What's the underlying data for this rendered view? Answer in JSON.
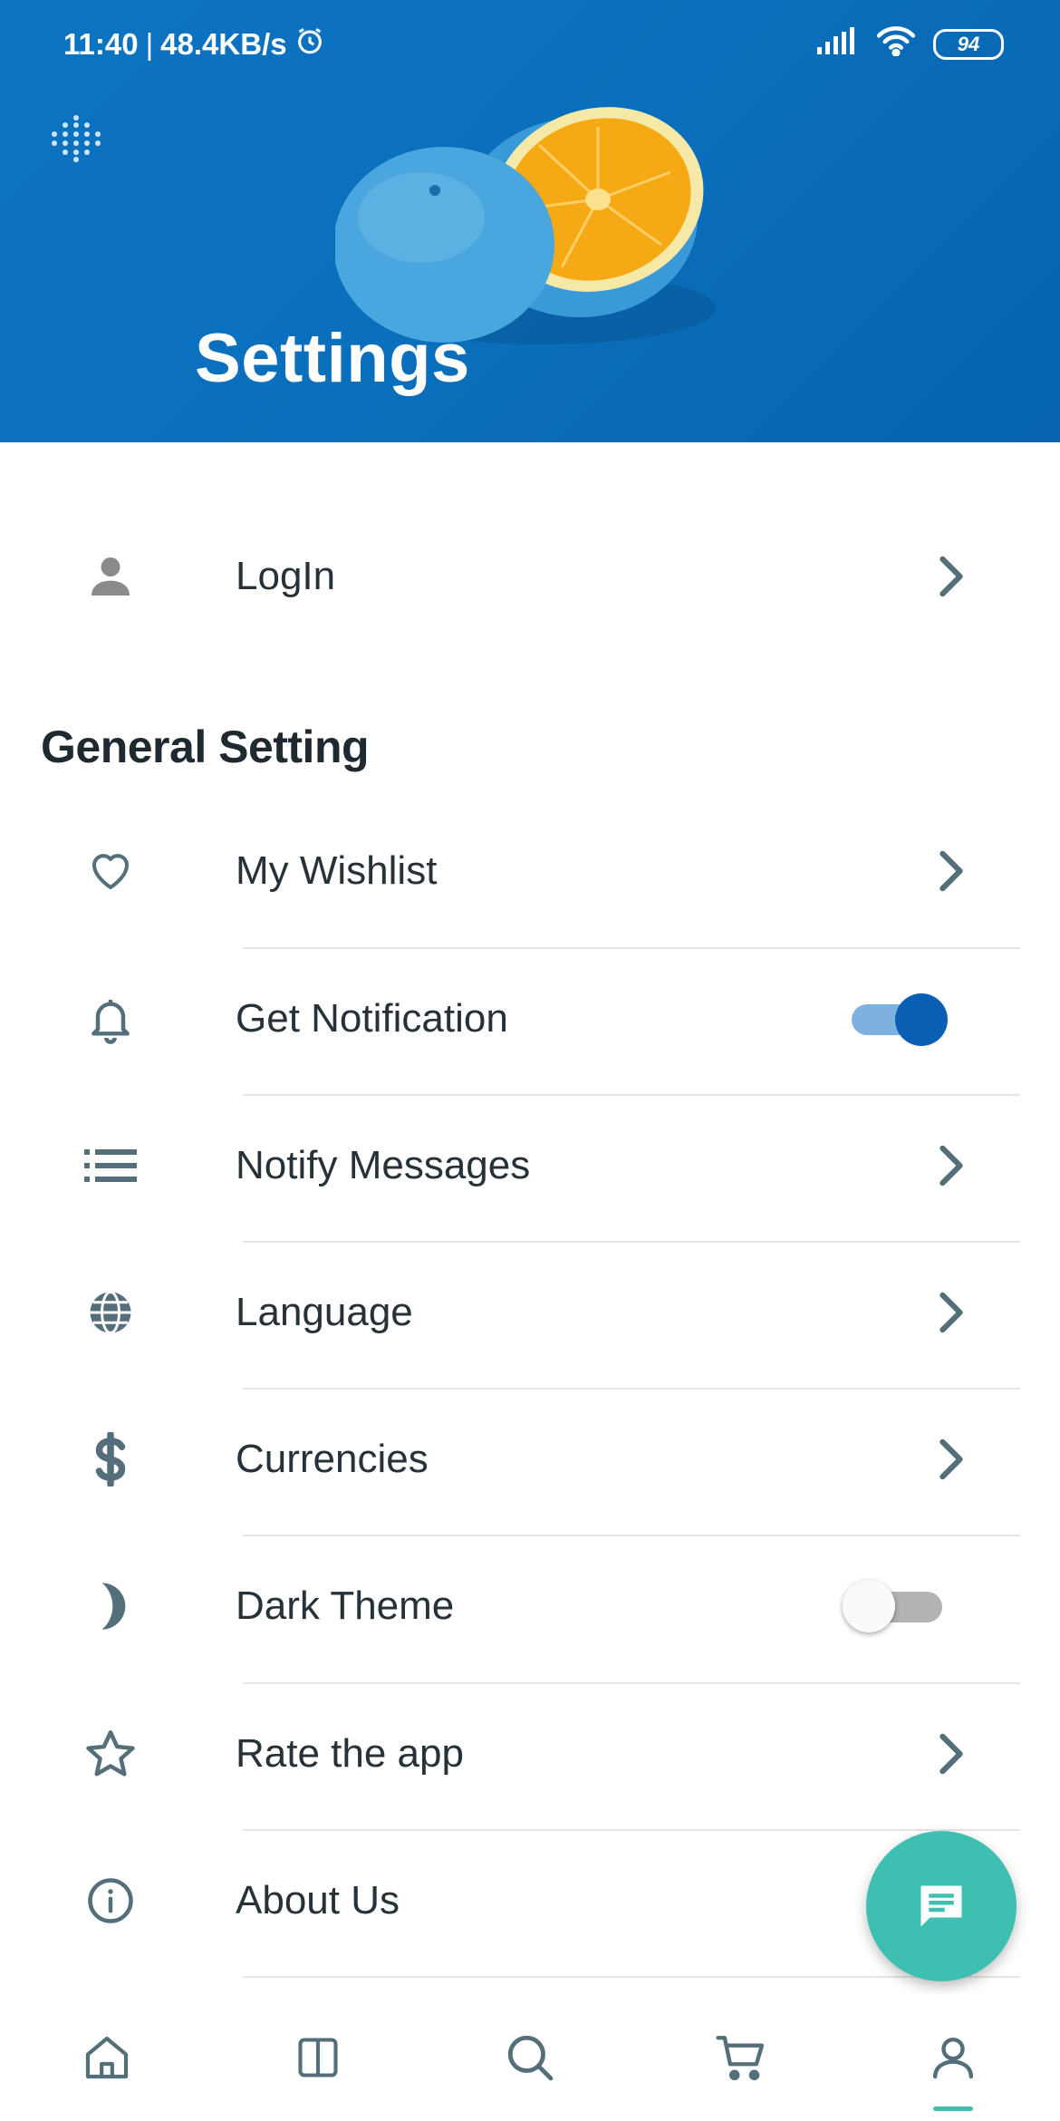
{
  "status_bar": {
    "time": "11:40",
    "separator": "|",
    "speed": "48.4KB/s",
    "battery": "94"
  },
  "header": {
    "title": "Settings"
  },
  "login_row": {
    "label": "LogIn",
    "icon": "person-icon"
  },
  "section": {
    "title": "General Setting"
  },
  "settings": [
    {
      "label": "My Wishlist",
      "icon": "heart-icon",
      "control": "chevron"
    },
    {
      "label": "Get Notification",
      "icon": "bell-icon",
      "control": "toggle",
      "enabled": true
    },
    {
      "label": "Notify Messages",
      "icon": "list-icon",
      "control": "chevron"
    },
    {
      "label": "Language",
      "icon": "globe-icon",
      "control": "chevron"
    },
    {
      "label": "Currencies",
      "icon": "dollar-icon",
      "control": "chevron"
    },
    {
      "label": "Dark Theme",
      "icon": "moon-icon",
      "control": "toggle",
      "enabled": false
    },
    {
      "label": "Rate the app",
      "icon": "star-icon",
      "control": "chevron"
    },
    {
      "label": "About Us",
      "icon": "info-icon",
      "control": "none"
    }
  ],
  "bottom_nav": [
    {
      "name": "home",
      "icon": "home-icon"
    },
    {
      "name": "categories",
      "icon": "columns-icon"
    },
    {
      "name": "search",
      "icon": "search-icon"
    },
    {
      "name": "cart",
      "icon": "cart-icon"
    },
    {
      "name": "profile",
      "icon": "profile-icon",
      "active": true
    }
  ],
  "colors": {
    "header_bg": "#0a6fbc",
    "accent": "#3fbfb1",
    "toggle_on": "#0a5fb4",
    "icon_gray": "#546e7a"
  }
}
